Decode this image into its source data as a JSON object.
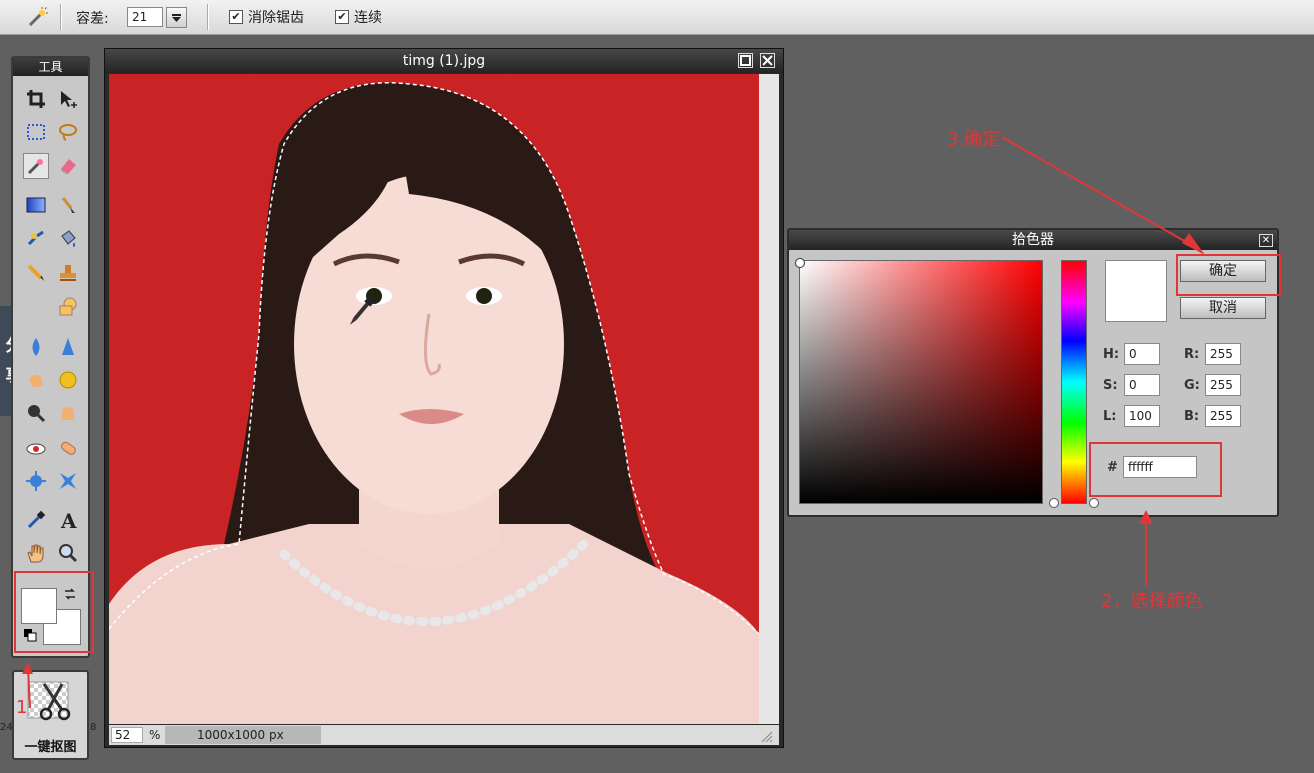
{
  "optionsbar": {
    "tolerance_label": "容差:",
    "tolerance_value": "21",
    "antialias_label": "消除锯齿",
    "contiguous_label": "连续",
    "antialias_checked": true,
    "contiguous_checked": true
  },
  "tools_panel": {
    "title": "工具"
  },
  "share_tab": {
    "line1": "分",
    "line2": "享"
  },
  "cutout": {
    "label": "一键抠图",
    "left_num": "24",
    "right_num": "8"
  },
  "image_window": {
    "title": "timg (1).jpg",
    "zoom": "52",
    "zoom_unit": "%",
    "dimensions": "1000x1000 px",
    "background_color": "#c92326"
  },
  "color_picker": {
    "title": "拾色器",
    "ok_label": "确定",
    "cancel_label": "取消",
    "h_label": "H:",
    "h_value": "0",
    "s_label": "S:",
    "s_value": "0",
    "l_label": "L:",
    "l_value": "100",
    "r_label": "R:",
    "r_value": "255",
    "g_label": "G:",
    "g_value": "255",
    "b_label": "B:",
    "b_value": "255",
    "hex_label": "#",
    "hex_value": "ffffff",
    "selected_color": "#ffffff"
  },
  "annotations": {
    "step1": "1",
    "step2": "2，选择颜色",
    "step3": "3.确定",
    "color": "#e03636"
  }
}
